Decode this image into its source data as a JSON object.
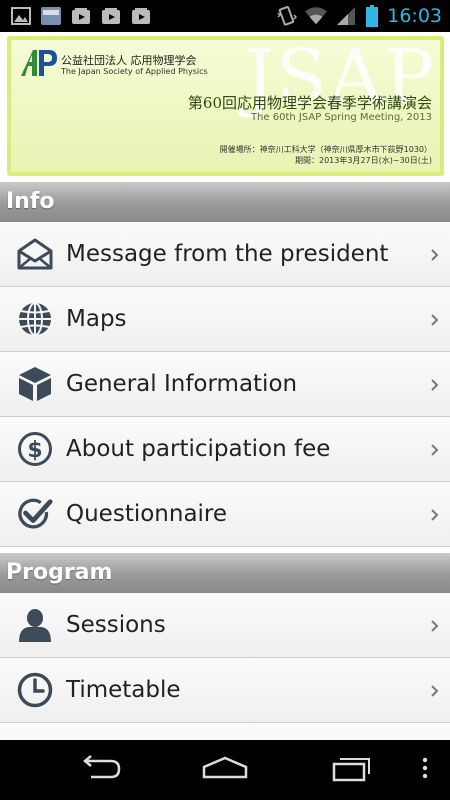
{
  "status_bar": {
    "time": "16:03",
    "left_icons": [
      "gallery-icon",
      "app-thumbnail-icon",
      "youtube-icon",
      "youtube-icon",
      "youtube-icon"
    ],
    "right_icons": [
      "vibrate-icon",
      "wifi-icon",
      "signal-icon",
      "battery-icon"
    ]
  },
  "banner": {
    "org_jp": "公益社団法人 応用物理学会",
    "org_en": "The Japan Society of Applied Physics",
    "bg_text": "JSAP",
    "meeting_jp": "第60回応用物理学会春季学術講演会",
    "meeting_en": "The 60th JSAP Spring Meeting, 2013",
    "venue": "開催場所：神奈川工科大学（神奈川県厚木市下荻野1030）",
    "dates": "期間：2013年3月27日(水)~30日(土)"
  },
  "sections": {
    "info": "Info",
    "program": "Program"
  },
  "info_items": [
    {
      "label": "Message from the president",
      "icon": "envelope-icon"
    },
    {
      "label": "Maps",
      "icon": "globe-icon"
    },
    {
      "label": "General Information",
      "icon": "cube-icon"
    },
    {
      "label": "About participation fee",
      "icon": "dollar-icon"
    },
    {
      "label": "Questionnaire",
      "icon": "check-circle-icon"
    }
  ],
  "program_items": [
    {
      "label": "Sessions",
      "icon": "person-icon"
    },
    {
      "label": "Timetable",
      "icon": "clock-icon"
    }
  ],
  "colors": {
    "clock": "#33b5e5",
    "icon": "#3d4a59",
    "banner_border": "#d8ee7a",
    "logo_green": "#2e8b3a",
    "logo_blue": "#1f4fa0"
  }
}
